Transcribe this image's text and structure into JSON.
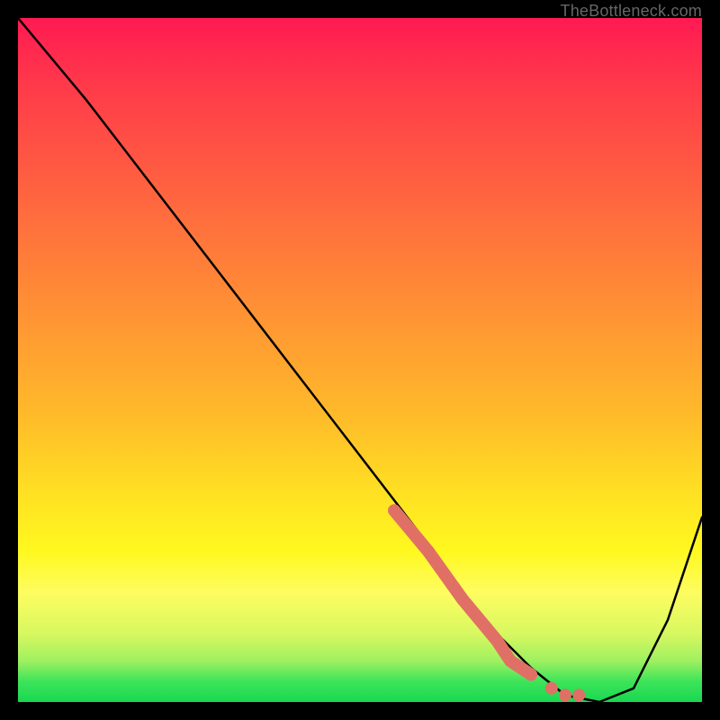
{
  "watermark": "TheBottleneck.com",
  "colors": {
    "background": "#000000",
    "curve": "#000000",
    "highlight": "#e07066",
    "gradient_top": "#ff1a52",
    "gradient_bottom": "#18d850"
  },
  "chart_data": {
    "type": "line",
    "title": "",
    "xlabel": "",
    "ylabel": "",
    "xlim": [
      0,
      100
    ],
    "ylim": [
      0,
      100
    ],
    "grid": false,
    "legend": false,
    "series": [
      {
        "name": "bottleneck-curve",
        "x": [
          0,
          10,
          20,
          30,
          40,
          50,
          60,
          65,
          70,
          75,
          80,
          85,
          90,
          95,
          100
        ],
        "y": [
          100,
          88,
          75,
          62,
          49,
          36,
          23,
          16,
          10,
          5,
          1,
          0,
          2,
          12,
          27
        ],
        "note": "y is percent height from bottom; curve descends steeply, flattens near x≈80, then rises"
      },
      {
        "name": "highlight-segment",
        "x": [
          55,
          60,
          65,
          70,
          72,
          75,
          78,
          80,
          82
        ],
        "y": [
          28,
          22,
          15,
          9,
          6,
          4,
          2,
          1,
          1
        ],
        "note": "coral/salmon thick dotted overlay along the descending limb approaching the trough"
      }
    ]
  }
}
